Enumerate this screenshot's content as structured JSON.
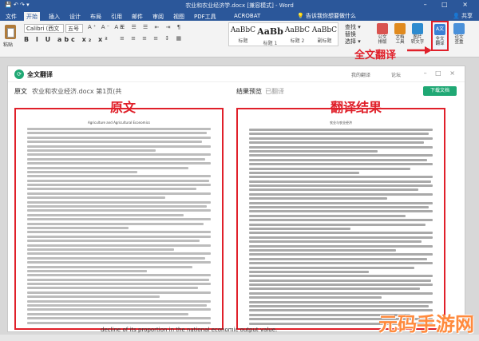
{
  "window": {
    "title": "农业和农业经济学.docx [兼容模式] - Word",
    "controls": "–  □  ×"
  },
  "ribbon_tabs": [
    "文件",
    "开始",
    "插入",
    "设计",
    "布局",
    "引用",
    "邮件",
    "审阅",
    "视图",
    "PDF工具",
    "ACROBAT"
  ],
  "active_tab": "开始",
  "tell_me": "告诉我你想要做什么",
  "share": "共享",
  "ribbon": {
    "paste_label": "粘贴",
    "font_name": "Calibri (西文",
    "font_size": "五号",
    "format_buttons": "B I U abc x₂ x²",
    "styles": [
      {
        "sample": "AaBbC",
        "name": "标题"
      },
      {
        "sample": "AaBb",
        "name": "标题 1"
      },
      {
        "sample": "AaBbC",
        "name": "标题 2"
      },
      {
        "sample": "AaBbC",
        "name": "副标题"
      }
    ],
    "edit_items": [
      "查找 ▾",
      "替换",
      "选择 ▾"
    ],
    "buttons": [
      {
        "label": "公文\n排版",
        "color": "#d9534f"
      },
      {
        "label": "文档\n工具",
        "color": "#e08a1e"
      },
      {
        "label": "图片\n转文字",
        "color": "#2e8bcf"
      }
    ],
    "full_translate_button": "全文\n翻译",
    "doc_check_button": "论文\n查重"
  },
  "callout": "全文翻译",
  "panel": {
    "title": "全文翻译",
    "my_translations": "我的翻译",
    "user": "论坛",
    "original_label": "原文",
    "file_name": "农业和农业经济.docx 第1页(共",
    "result_label": "结果预览",
    "result_status": "已翻译",
    "download_button": "下载文档",
    "doc_title_en": "Agriculture and Agricultural Economics",
    "doc_title_zh": "农业与农业经济"
  },
  "annotations": {
    "original": "原文",
    "result": "翻译结果"
  },
  "bottom_text": "decline of its proportion in the national economic output value.",
  "watermark": "元码手游网"
}
